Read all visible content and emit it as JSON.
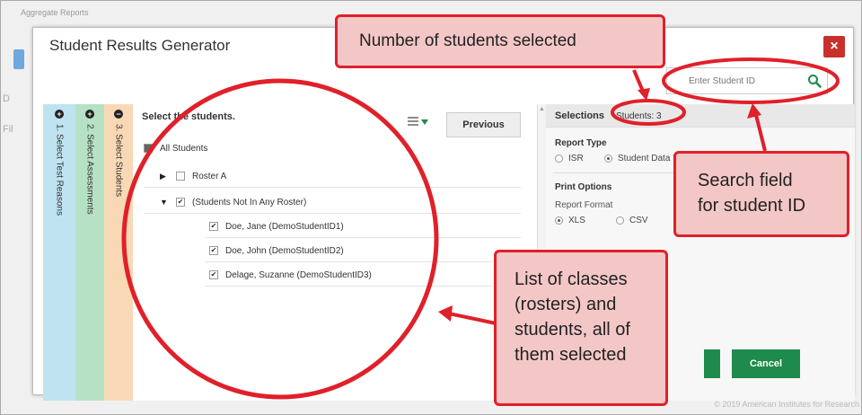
{
  "background": {
    "title": "Aggregate Reports",
    "footer": "© 2019 American Institutes for Research"
  },
  "modal": {
    "title": "Student Results Generator",
    "close_label": "×"
  },
  "search": {
    "placeholder": "Enter Student ID"
  },
  "steps": [
    {
      "label": "1. Select Test Reasons",
      "icon": "plus"
    },
    {
      "label": "2. Select Assessments",
      "icon": "plus"
    },
    {
      "label": "3. Select Students",
      "icon": "minus"
    }
  ],
  "student_list": {
    "title": "Select the students.",
    "previous_label": "Previous",
    "all_students": "All Students",
    "rows": [
      {
        "label": "Roster A",
        "checked": false
      },
      {
        "label": "(Students Not In Any Roster)",
        "checked": true
      },
      {
        "label": "Doe, Jane (DemoStudentID1)",
        "checked": true
      },
      {
        "label": "Doe, John (DemoStudentID2)",
        "checked": true
      },
      {
        "label": "Delage, Suzanne (DemoStudentID3)",
        "checked": true
      }
    ]
  },
  "selections": {
    "title": "Selections",
    "students_count": "Students: 3",
    "report_type_label": "Report Type",
    "report_type_options": [
      "ISR",
      "Student Data File"
    ],
    "report_type_selected": "Student Data File",
    "print_options_label": "Print Options",
    "report_format_label": "Report Format",
    "report_format_options": [
      "XLS",
      "CSV"
    ],
    "report_format_selected": "XLS",
    "cancel_label": "Cancel"
  },
  "callouts": {
    "number_selected": "Number of students selected",
    "search_field_line1": "Search field",
    "search_field_line2": "for student ID",
    "list_line1": "List of classes",
    "list_line2": "(rosters) and",
    "list_line3": "students, all of",
    "list_line4": "them selected"
  },
  "colors": {
    "callout_border": "#e0202a",
    "callout_fill": "#f4c7c7",
    "step1": "#bfe3f0",
    "step2": "#b7e1c5",
    "step3": "#f9d9b5",
    "action_green": "#1e8a4c",
    "close_red": "#c9302c"
  }
}
